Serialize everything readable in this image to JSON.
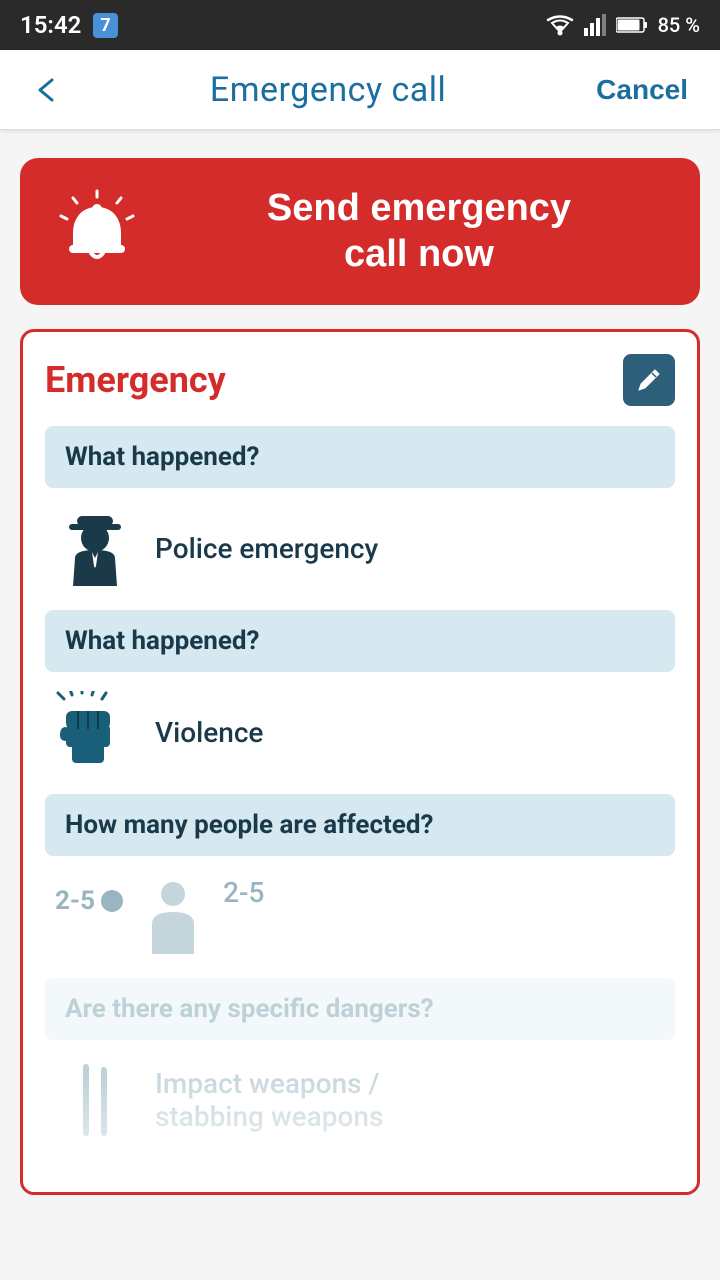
{
  "statusBar": {
    "time": "15:42",
    "notification": "7",
    "battery": "85 %"
  },
  "header": {
    "title": "Emergency call",
    "cancelLabel": "Cancel",
    "backIcon": "←"
  },
  "emergencyButton": {
    "label": "Send emergency\ncall now",
    "icon": "alarm-bell"
  },
  "card": {
    "title": "Emergency",
    "editIcon": "pencil-icon",
    "sections": [
      {
        "question": "What happened?",
        "answerText": "Police emergency",
        "answerIcon": "police-officer-icon",
        "faded": false
      },
      {
        "question": "What happened?",
        "answerText": "Violence",
        "answerIcon": "fist-icon",
        "faded": false
      },
      {
        "question": "How many people are affected?",
        "countLabel": "2-5",
        "answerText": "2-5",
        "answerIcon": "person-icon",
        "faded": false
      },
      {
        "question": "Are there any specific dangers?",
        "answerText": "Impact weapons /\nstabbing weapons",
        "answerIcon": "weapons-icon",
        "faded": true
      }
    ]
  }
}
